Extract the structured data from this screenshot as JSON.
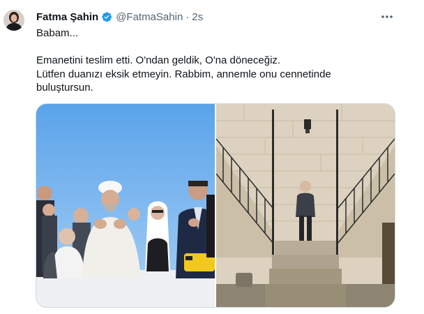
{
  "tweet": {
    "author_name": "Fatma Şahin",
    "handle": "@FatmaSahin",
    "separator": "·",
    "time": "2s",
    "lines": [
      "Babam...",
      "",
      "Emanetini teslim etti. O'ndan geldik, O'na döneceğiz.",
      "Lütfen duanızı eksik etmeyin. Rabbim, annemle onu cennetinde",
      "buluştursun."
    ]
  },
  "icons": {
    "verified": "verified-badge-icon",
    "more": "more-options-icon"
  },
  "colors": {
    "accent": "#1d9bf0",
    "text": "#0f1419",
    "secondary": "#536471",
    "border": "#cfd9de"
  }
}
